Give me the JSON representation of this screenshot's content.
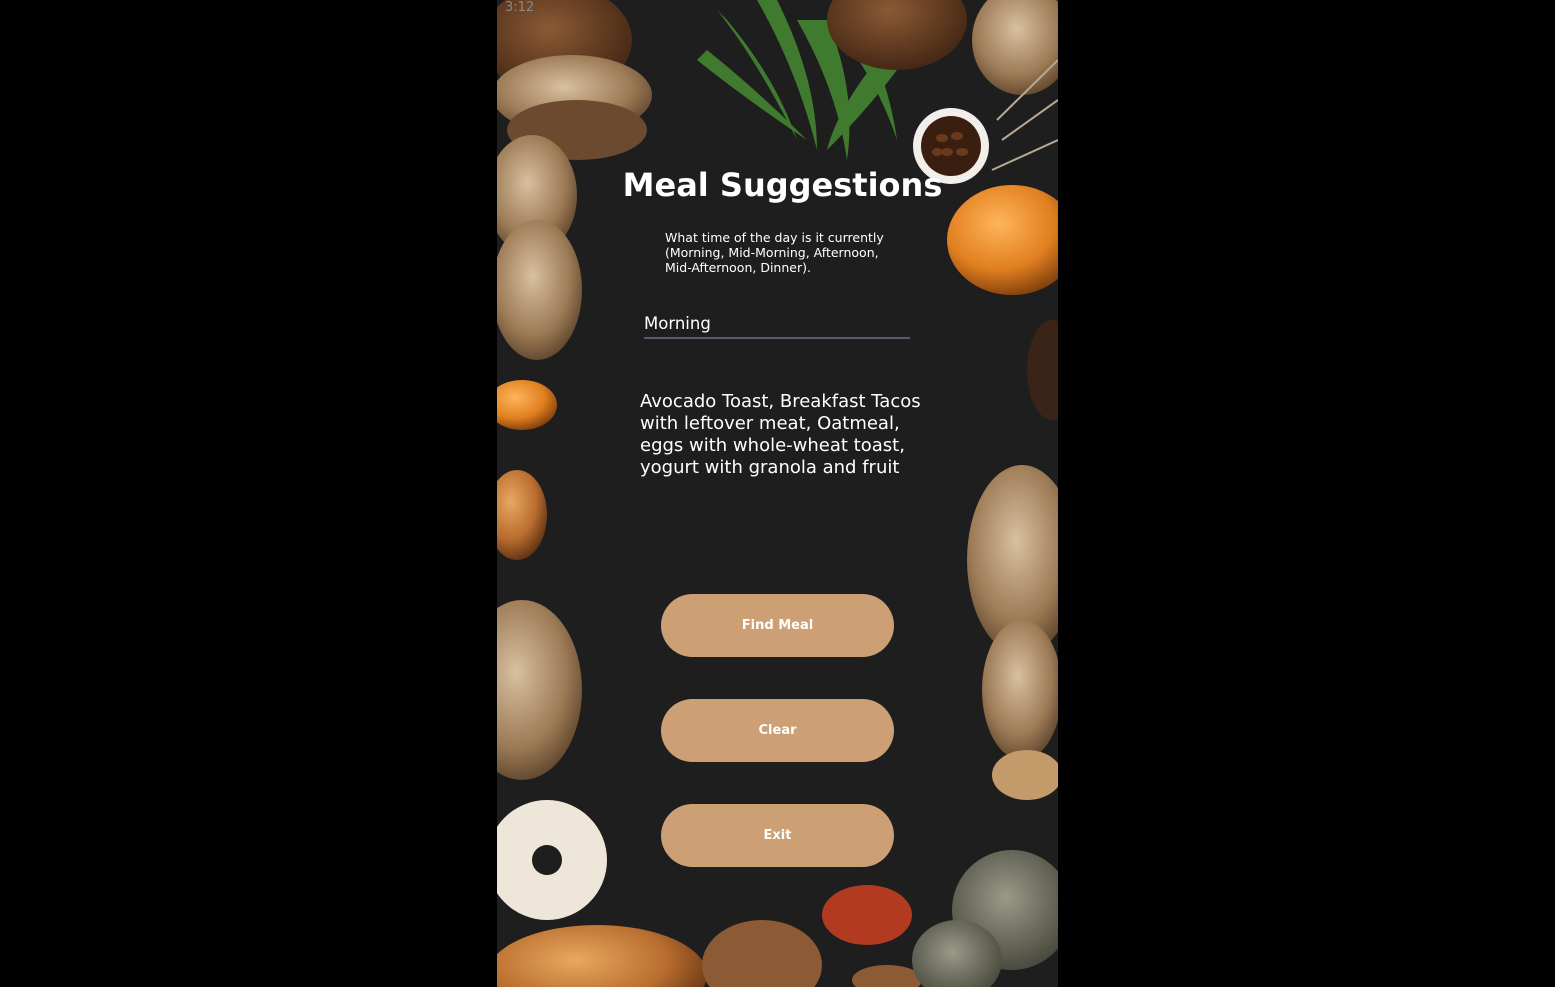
{
  "status_bar": {
    "time": "3:12"
  },
  "header": {
    "title": "Meal Suggestions"
  },
  "prompt": {
    "text": "What time of the day is it currently (Morning, Mid-Morning, Afternoon, Mid-Afternoon, Dinner)."
  },
  "time_input": {
    "value": "Morning"
  },
  "result": {
    "text": "Avocado Toast, Breakfast Tacos with leftover meat, Oatmeal, eggs with whole-wheat toast, yogurt with granola and fruit"
  },
  "buttons": {
    "find_meal": "Find Meal",
    "clear": "Clear",
    "exit": "Exit"
  },
  "colors": {
    "background": "#1c1c1c",
    "button": "#cd9f74",
    "text": "#ffffff",
    "underline": "#5a5a6e"
  }
}
